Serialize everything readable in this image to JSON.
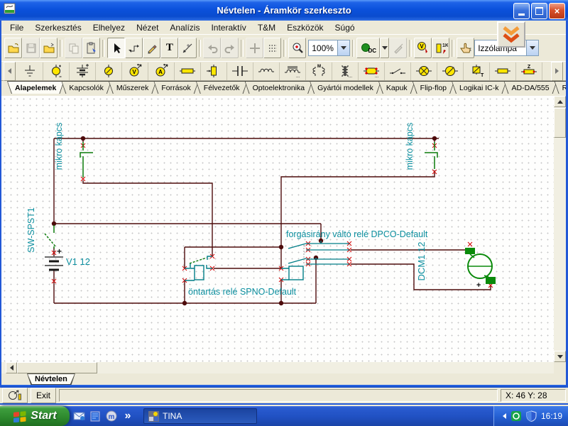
{
  "window": {
    "title": "Névtelen - Áramkör szerkeszto"
  },
  "menu": {
    "items": [
      "File",
      "Szerkesztés",
      "Elhelyez",
      "Nézet",
      "Analízis",
      "Interaktív",
      "T&M",
      "Eszközök",
      "Súgó"
    ]
  },
  "toolbar": {
    "zoom_value": "100%",
    "component_combo_value": "Izzólámpa",
    "dc_badge": "DC",
    "text_tool_glyph": "T",
    "voltmeter_glyph": "V",
    "resistor_tool_glyph": "1K"
  },
  "palette": {
    "voltmeter_glyph": "V",
    "ammeter_glyph": "A",
    "coupled_glyph": "M",
    "relay_glyph": "T",
    "impedance_glyph": "Z",
    "dots": "..."
  },
  "tabs": {
    "items": [
      "Alapelemek",
      "Kapcsolók",
      "Műszerek",
      "Források",
      "Félvezetők",
      "Optoelektronika",
      "Gyártói modellek",
      "Kapuk",
      "Flip-flop",
      "Logikai IC-k",
      "AD-DA/555",
      "RF"
    ]
  },
  "canvas": {
    "labels": {
      "micro_switch_left": "mikro kapcs",
      "micro_switch_right": "mikro kapcs",
      "main_switch": "SW-SPST1",
      "battery": "V1 12",
      "battery_polarity": "+",
      "latch_relay": "öntartás relé SPNO-Default",
      "reversing_relay": "forgásirány váltó relé DPCO-Default",
      "motor": "DCM1 12",
      "motor_polarity": "+"
    },
    "colors": {
      "wire": "#4d0b0b",
      "component_teal": "#007d87",
      "label_teal": "#0c8f9f",
      "terminal_red": "#d40000",
      "switch_green": "#0a7a0a"
    }
  },
  "document_tab": {
    "label": "Névtelen"
  },
  "statusbar": {
    "exit_label": "Exit",
    "coordinates": "X: 46 Y: 28"
  },
  "taskbar": {
    "start_label": "Start",
    "quick_launch_overflow": "»",
    "msn_glyph": "m",
    "task_label": "TINA",
    "clock": "16:19"
  }
}
